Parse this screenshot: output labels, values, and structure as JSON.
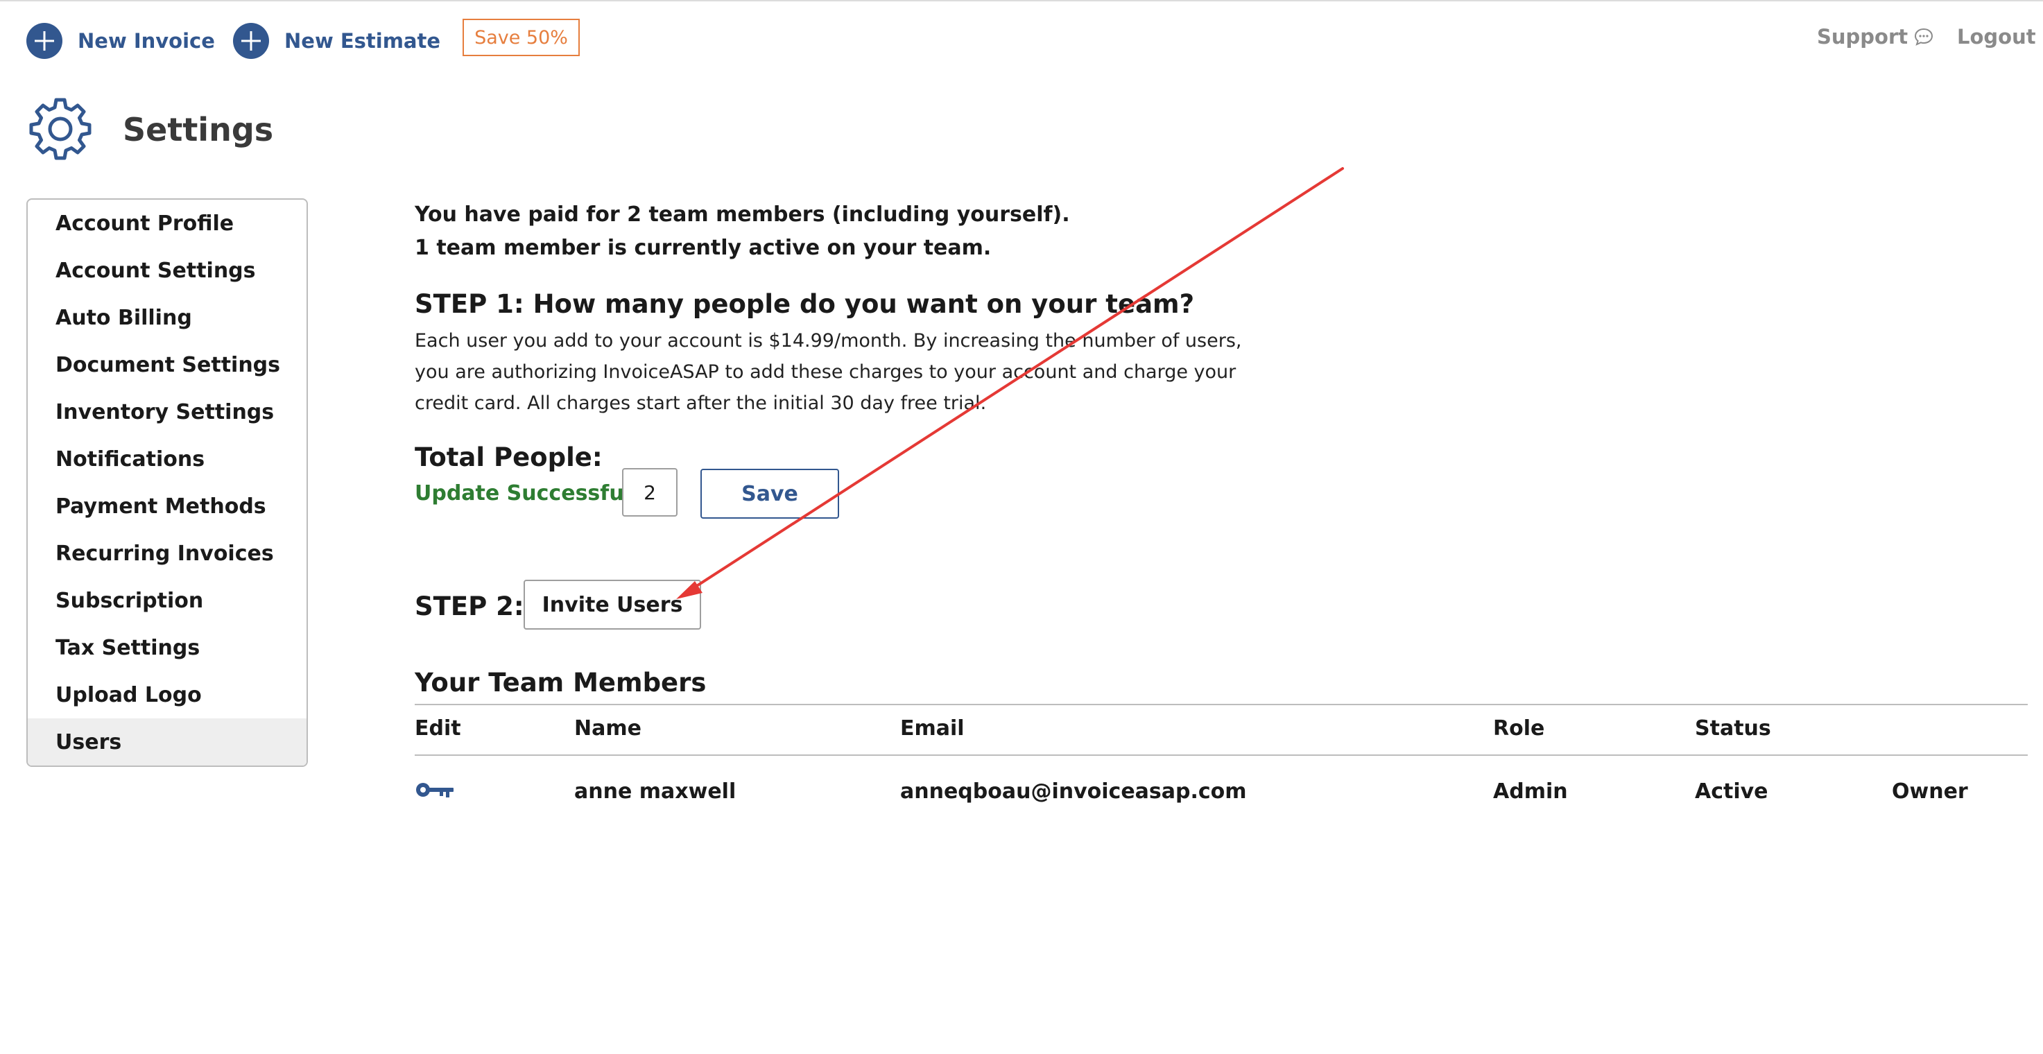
{
  "header": {
    "new_invoice": "New Invoice",
    "new_estimate": "New Estimate",
    "promo": "Save 50%",
    "support": "Support",
    "logout": "Logout"
  },
  "page": {
    "title": "Settings"
  },
  "sidebar": {
    "items": [
      {
        "label": "Account Profile"
      },
      {
        "label": "Account Settings"
      },
      {
        "label": "Auto Billing"
      },
      {
        "label": "Document Settings"
      },
      {
        "label": "Inventory Settings"
      },
      {
        "label": "Notifications"
      },
      {
        "label": "Payment Methods"
      },
      {
        "label": "Recurring Invoices"
      },
      {
        "label": "Subscription"
      },
      {
        "label": "Tax Settings"
      },
      {
        "label": "Upload Logo"
      },
      {
        "label": "Users",
        "active": true
      }
    ]
  },
  "summary": {
    "paid_line": "You have paid for 2 team members (including yourself).",
    "active_line": "1 team member is currently active on your team."
  },
  "step1": {
    "heading": "STEP 1: How many people do you want on your team?",
    "description_lines": [
      "Each user you add to your account is $14.99/month. By increasing the number of users,",
      "you are authorizing InvoiceASAP to add these charges to your account and charge your",
      "credit card. All charges start after the initial 30 day free trial."
    ],
    "total_label": "Total People:",
    "status": "Update Successful",
    "total_value": "2",
    "save_label": "Save"
  },
  "step2": {
    "label": "STEP 2:",
    "invite_label": "Invite Users"
  },
  "team": {
    "heading": "Your Team Members",
    "columns": [
      "Edit",
      "Name",
      "Email",
      "Role",
      "Status"
    ],
    "rows": [
      {
        "edit_icon": "key-icon",
        "name": "anne maxwell",
        "email": "anneqboau@invoiceasap.com",
        "role": "Admin",
        "status": "Active",
        "type": "Owner"
      }
    ]
  },
  "colors": {
    "brand_blue": "#32578f",
    "promo_orange": "#e67e3e",
    "success_green": "#2e7d32",
    "annotation_red": "#e53935"
  }
}
